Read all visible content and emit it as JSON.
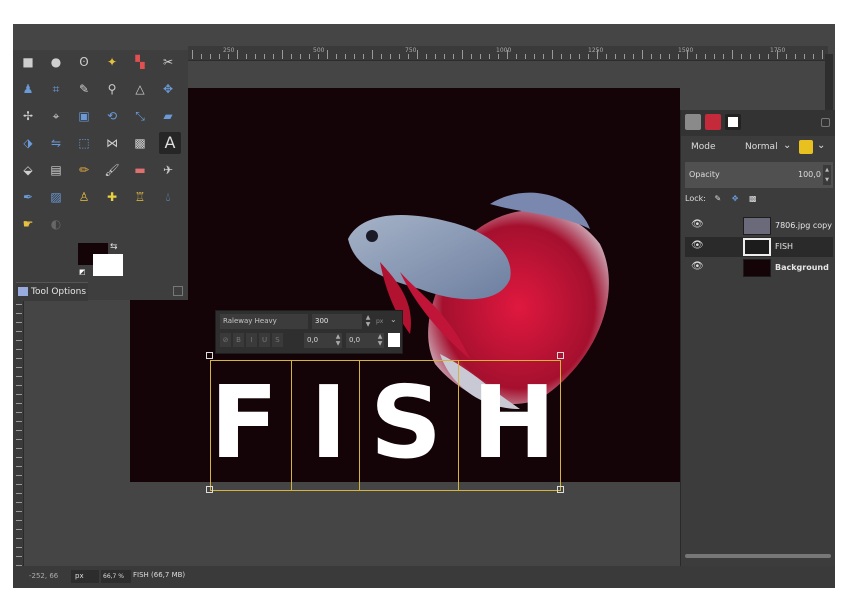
{
  "rulers": {
    "h_labels": [
      "250",
      "500",
      "750",
      "1000",
      "1250",
      "1500",
      "1750"
    ]
  },
  "toolbox": {
    "tools": [
      "rect-select-icon",
      "ellipse-select-icon",
      "lasso-icon",
      "fuzzy-select-icon",
      "color-select-icon",
      "scissors-icon",
      "foreground-select-icon",
      "paths-icon",
      "color-picker-icon",
      "zoom-icon",
      "measure-icon",
      "move-icon",
      "align-icon",
      "crop-icon",
      "unified-transform-icon",
      "rotate-icon",
      "scale-icon",
      "shear-icon",
      "perspective-icon",
      "flip-icon",
      "cage-icon",
      "warp-icon",
      "text-icon",
      "bucket-fill-icon",
      "gradient-icon",
      "pencil-icon",
      "paintbrush-icon",
      "eraser-icon",
      "airbrush-icon",
      "ink-icon",
      "mypaint-icon",
      "clone-icon",
      "heal-icon",
      "perspective-clone-icon",
      "blur-icon",
      "smudge-icon",
      "dodge-icon"
    ],
    "active_tool": "text-icon",
    "fg_color": "#140307",
    "bg_color": "#ffffff"
  },
  "tool_options_tab": "Tool Options",
  "text_toolbar": {
    "font": "Raleway Heavy",
    "size": "300",
    "unit": "px",
    "baseline": "0,0",
    "kerning": "0,0"
  },
  "canvas": {
    "text": "FISH",
    "letters": [
      "F",
      "I",
      "S",
      "H"
    ],
    "bg_color": "#140307"
  },
  "layers_panel": {
    "mode_label": "Mode",
    "mode_value": "Normal",
    "opacity_label": "Opacity",
    "opacity_value": "100,0",
    "lock_label": "Lock:",
    "layers": [
      {
        "name": "7806.jpg copy",
        "selected": false,
        "bold": false
      },
      {
        "name": "FISH",
        "selected": true,
        "bold": false
      },
      {
        "name": "Background",
        "selected": false,
        "bold": true
      }
    ]
  },
  "status_bar": {
    "coords": "-252, 66",
    "unit": "px",
    "zoom": "66,7 %",
    "message": "FISH (66,7 MB)"
  }
}
